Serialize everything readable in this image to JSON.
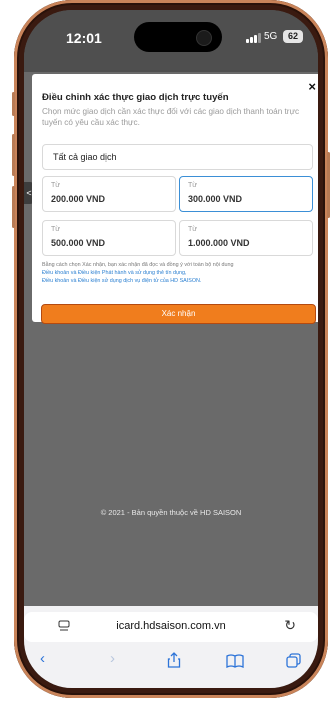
{
  "status": {
    "time": "12:01",
    "network": "5G",
    "battery": "62"
  },
  "modal": {
    "title": "Điều chỉnh xác thực giao dịch trực tuyến",
    "subtitle": "Chọn mức giao dịch cần xác thực đối với các giao dịch thanh toán trực tuyến có yêu cầu xác thực.",
    "close_label": "×",
    "all_option": "Tất cả giao dịch",
    "options": [
      {
        "label": "Từ",
        "value": "200.000 VND",
        "selected": false
      },
      {
        "label": "Từ",
        "value": "300.000 VND",
        "selected": true
      },
      {
        "label": "Từ",
        "value": "500.000 VND",
        "selected": false
      },
      {
        "label": "Từ",
        "value": "1.000.000 VND",
        "selected": false
      }
    ],
    "terms": {
      "line1": "Bằng cách chọn Xác nhận, bạn xác nhận đã đọc và đồng ý với toàn bộ nội dung",
      "link1": "Điều khoản và Điều kiện Phát hành và sử dụng thẻ tín dụng,",
      "link2": "Điều khoản và Điều kiện sử dụng dịch vụ điện tử của HD SAISON."
    },
    "confirm_label": "Xác nhận"
  },
  "page": {
    "copyright": "© 2021 - Bản quyền thuộc về HD SAISON",
    "left_tab": "<"
  },
  "browser": {
    "url": "icard.hdsaison.com.vn",
    "reload_icon": "reload-icon",
    "toolbar_icons": [
      "back-icon",
      "forward-icon",
      "share-icon",
      "bookmarks-icon",
      "tabs-icon"
    ]
  },
  "colors": {
    "accent": "#f07d1d",
    "link": "#2a7fd1",
    "selected_border": "#3b8fd6",
    "toolbar_icon": "#2d74d8"
  }
}
